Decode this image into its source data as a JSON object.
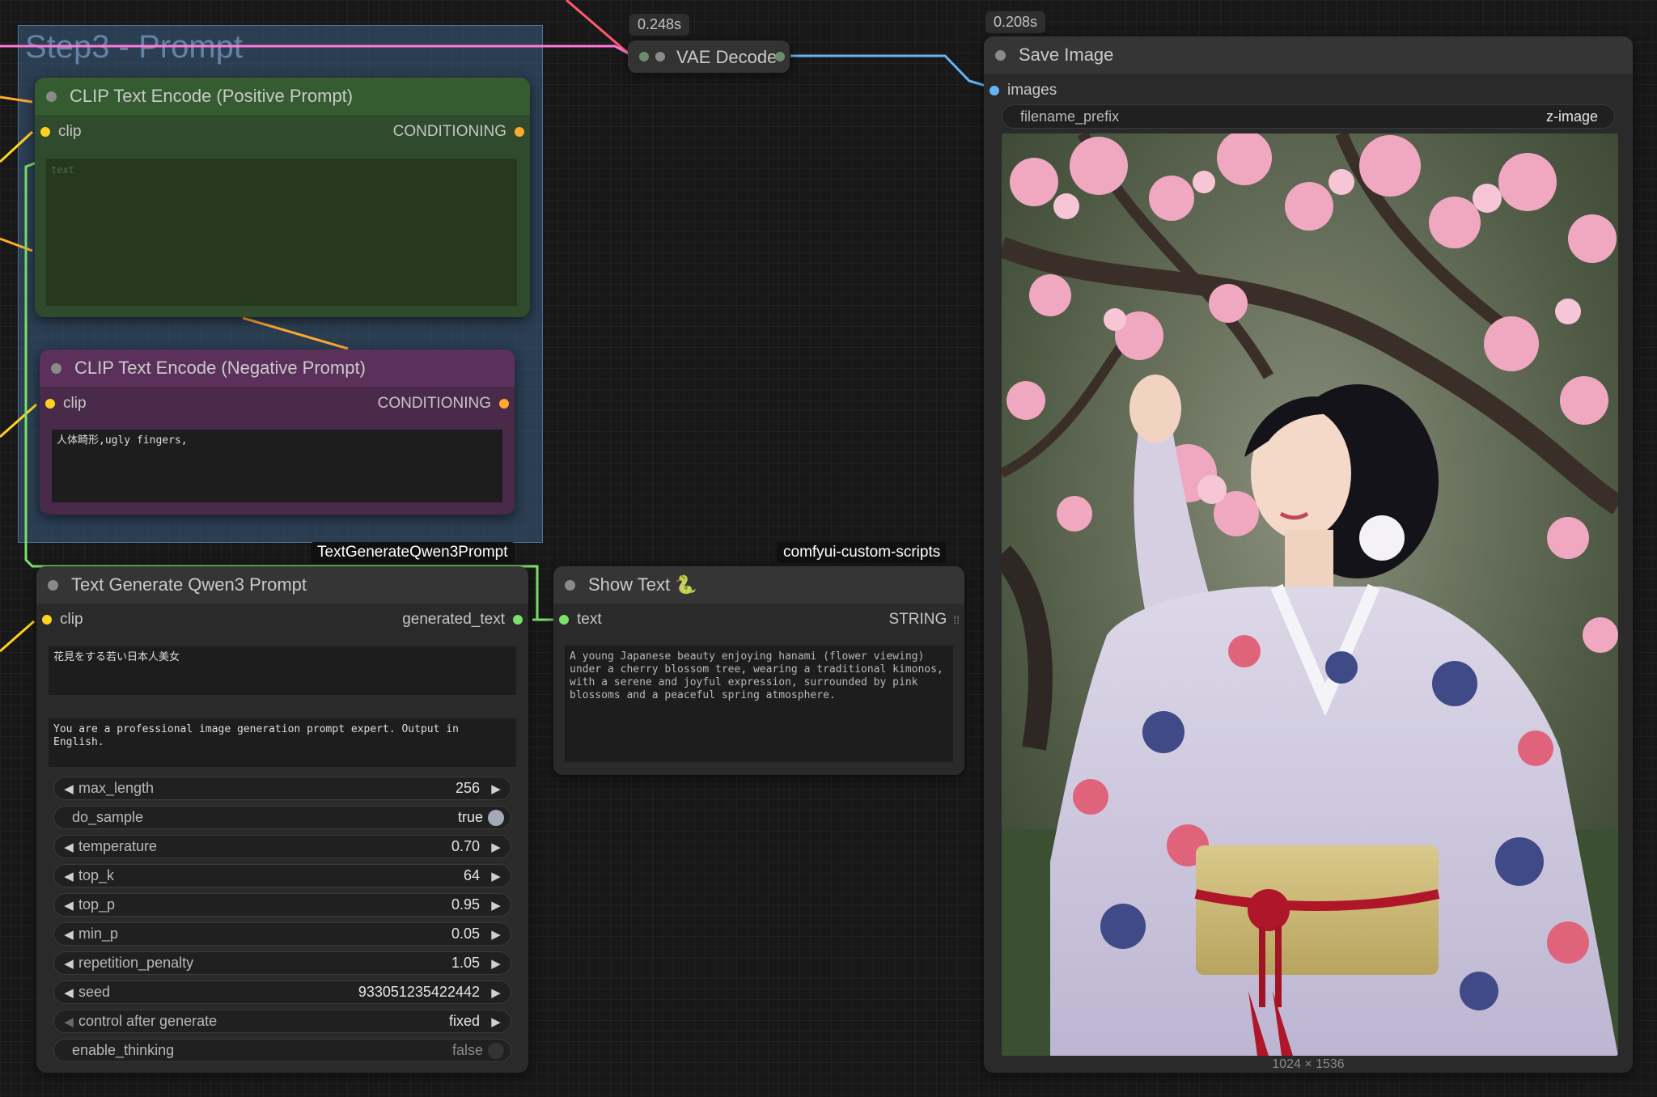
{
  "group": {
    "title": "Step3 - Prompt"
  },
  "badges": {
    "vae_time": "0.248s",
    "save_time": "0.208s"
  },
  "vae_decode": {
    "title": "VAE Decode"
  },
  "clip_positive": {
    "title": "CLIP Text Encode (Positive Prompt)",
    "input": "clip",
    "output": "CONDITIONING",
    "placeholder": "text"
  },
  "clip_negative": {
    "title": "CLIP Text Encode (Negative Prompt)",
    "input": "clip",
    "output": "CONDITIONING",
    "text": "人体畸形,ugly fingers,"
  },
  "qwen": {
    "label": "TextGenerateQwen3Prompt",
    "title": "Text Generate Qwen3 Prompt",
    "input": "clip",
    "output": "generated_text",
    "prompt_text": "花見をする若い日本人美女",
    "system_text": "You are a professional image generation prompt expert. Output in English.",
    "widgets": [
      {
        "name": "max_length",
        "value": "256",
        "kind": "number"
      },
      {
        "name": "do_sample",
        "value": "true",
        "kind": "toggle_on"
      },
      {
        "name": "temperature",
        "value": "0.70",
        "kind": "number"
      },
      {
        "name": "top_k",
        "value": "64",
        "kind": "number"
      },
      {
        "name": "top_p",
        "value": "0.95",
        "kind": "number"
      },
      {
        "name": "min_p",
        "value": "0.05",
        "kind": "number"
      },
      {
        "name": "repetition_penalty",
        "value": "1.05",
        "kind": "number"
      },
      {
        "name": "seed",
        "value": "933051235422442",
        "kind": "number"
      },
      {
        "name": "control after generate",
        "value": "fixed",
        "kind": "combo"
      },
      {
        "name": "enable_thinking",
        "value": "false",
        "kind": "toggle_off"
      }
    ]
  },
  "show_text": {
    "label": "comfyui-custom-scripts",
    "title": "Show Text 🐍",
    "input": "text",
    "output": "STRING",
    "content": "A young Japanese beauty enjoying hanami (flower viewing) under a cherry blossom tree, wearing a traditional kimonos, with a serene and joyful expression, surrounded by pink blossoms and a peaceful spring atmosphere."
  },
  "save_image": {
    "title": "Save Image",
    "input": "images",
    "filename_prefix_label": "filename_prefix",
    "filename_prefix_value": "z-image",
    "image_size": "1024 × 1536"
  },
  "colors": {
    "clip_wire": "#ffd21f",
    "conditioning_wire": "#ffa931",
    "string_wire": "#7ce06a",
    "image_wire": "#64b5f6",
    "vae_wire": "#ff6e9c"
  }
}
